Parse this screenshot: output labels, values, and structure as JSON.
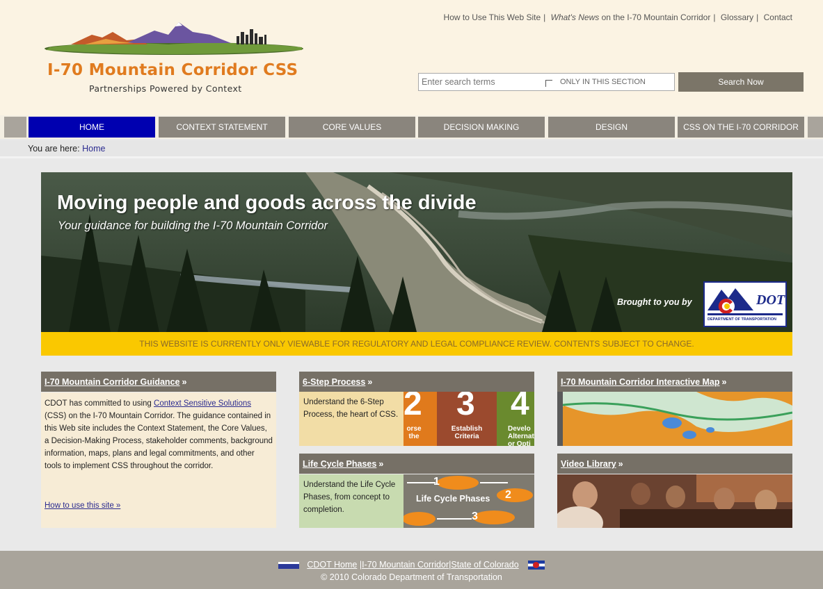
{
  "header": {
    "logo_title": "I-70 Mountain Corridor CSS",
    "logo_tagline": "Partnerships Powered by Context",
    "utility_links": {
      "how_to_use": "How to Use This Web Site",
      "whats_news_prefix": "What's News",
      "whats_news_suffix": " on the I-70 Mountain Corridor",
      "glossary": "Glossary",
      "contact": "Contact"
    },
    "search": {
      "placeholder": "Enter search terms",
      "section_label": "ONLY IN THIS SECTION",
      "button_label": "Search Now"
    }
  },
  "nav": {
    "tabs": [
      {
        "label": "HOME",
        "active": true
      },
      {
        "label": "CONTEXT STATEMENT",
        "active": false
      },
      {
        "label": "CORE VALUES",
        "active": false
      },
      {
        "label": "DECISION MAKING",
        "active": false
      },
      {
        "label": "DESIGN",
        "active": false
      },
      {
        "label": "CSS ON THE I-70 CORRIDOR",
        "active": false
      }
    ],
    "active_color": "#0000b0"
  },
  "breadcrumb": {
    "prefix": "You are here:",
    "current": "Home"
  },
  "hero": {
    "title": "Moving people and goods across the divide",
    "subtitle": "Your guidance for building the I-70 Mountain Corridor",
    "brought_by": "Brought to you by",
    "cdot_logo_text": "DOT",
    "cdot_logo_caption": "DEPARTMENT OF TRANSPORTATION"
  },
  "notice": "THIS WEBSITE IS CURRENTLY ONLY VIEWABLE FOR REGULATORY AND LEGAL COMPLIANCE REVIEW. CONTENTS SUBJECT TO CHANGE.",
  "panels": {
    "guidance": {
      "title": "I-70 Mountain Corridor Guidance",
      "arrow": "»",
      "text_1": "CDOT has committed to using ",
      "link": "Context Sensitive Solutions",
      "text_2": " (CSS) on the I-70 Mountain Corridor. The guidance contained in this Web site includes the Context Statement, the Core Values, a Decision-Making Process, stakeholder comments, background information, maps, plans and legal commitments, and other tools to implement CSS throughout the corridor.",
      "how_to_link": "How to use this site »"
    },
    "six_step": {
      "title": "6-Step Process",
      "arrow": "»",
      "text": "Understand the 6-Step Process, the heart of CSS.",
      "steps": [
        {
          "num": "2",
          "label": "orse\nthe"
        },
        {
          "num": "3",
          "label": "Establish\nCriteria"
        },
        {
          "num": "4",
          "label": "Develo\nAlternati\nor Opti"
        }
      ]
    },
    "life_cycle": {
      "title": "Life Cycle Phases",
      "arrow": "»",
      "text": "Understand the Life Cycle Phases, from concept to completion.",
      "diagram_title": "Life Cycle Phases",
      "phase_numbers": [
        "1",
        "2",
        "3"
      ]
    },
    "map": {
      "title": "I-70 Mountain Corridor Interactive Map",
      "arrow": "»"
    },
    "video": {
      "title": "Video Library",
      "arrow": "»"
    }
  },
  "footer": {
    "links": [
      "CDOT Home",
      "I-70 Mountain Corridor",
      "State of Colorado"
    ],
    "copyright": "© 2010 Colorado Department of Transportation"
  }
}
